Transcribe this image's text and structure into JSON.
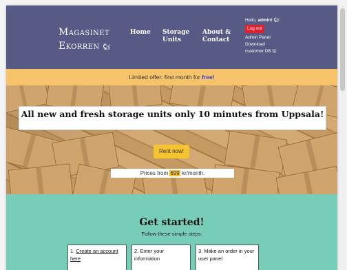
{
  "header": {
    "logo_line1": "Magasinet",
    "logo_line2": "Ekorren",
    "logo_icon": "🐿",
    "nav": {
      "home": "Home",
      "units": "Storage Units",
      "about": "About & Contact"
    }
  },
  "user": {
    "greeting": "Hello, ",
    "name": "admin!",
    "greeting_icon": "🐿",
    "logout": "Log out",
    "admin_panel": "Admin Panel",
    "download": "Download",
    "customer_db": "customer DB",
    "db_icon": "🖫"
  },
  "offer": {
    "text": "Limited offer: first month for ",
    "highlight": "free!"
  },
  "hero": {
    "title": "All new and fresh storage units only 10 minutes from Uppsala!",
    "button": "Rent now!",
    "price_prefix": "Prices from ",
    "price_value": "699",
    "price_suffix": " kr/month."
  },
  "started": {
    "title": "Get started!",
    "subtitle": "Follow these simple steps:",
    "steps": [
      {
        "num": "1. ",
        "text": "Create an account here"
      },
      {
        "num": "2. ",
        "text": "Enter your information"
      },
      {
        "num": "3. ",
        "text": "Make an order in your user panel"
      }
    ]
  },
  "colors": {
    "header_bg": "#565a84",
    "offer_bg": "#f6c36b",
    "accent_yellow": "#f6c432",
    "logout_red": "#e0202c",
    "started_bg": "#78cdb8"
  }
}
